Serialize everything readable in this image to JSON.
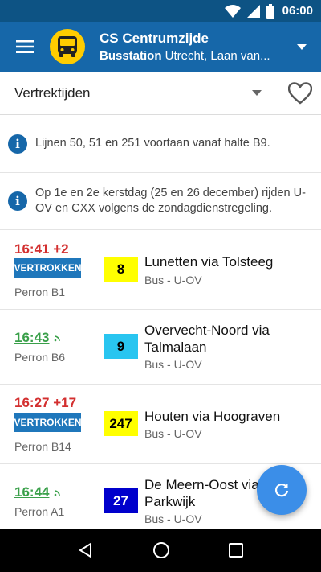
{
  "status": {
    "time": "06:00"
  },
  "app": {
    "title": "CS Centrumzijde",
    "subtitle_bold": "Busstation",
    "subtitle_rest": " Utrecht, Laan van..."
  },
  "filter": {
    "selected": "Vertrektijden"
  },
  "notices": [
    {
      "text": "Lijnen 50, 51 en 251 voortaan vanaf halte B9."
    },
    {
      "text": "Op 1e en 2e kerstdag (25 en 26 december) rijden U-OV en CXX volgens de zondagdienstregeling."
    }
  ],
  "departures": [
    {
      "time": "16:41 +2",
      "status": "VERTROKKEN",
      "perron": "Perron B1",
      "line": "8",
      "line_bg": "#ffff00",
      "line_fg": "#000000",
      "destination": "Lunetten via Tolsteeg",
      "mode": "Bus - U-OV"
    },
    {
      "time": "16:43",
      "perron": "Perron B6",
      "line": "9",
      "line_bg": "#29c5f0",
      "line_fg": "#000000",
      "destination": "Overvecht-Noord via Talmalaan",
      "mode": "Bus - U-OV"
    },
    {
      "time": "16:27 +17",
      "status": "VERTROKKEN",
      "perron": "Perron B14",
      "line": "247",
      "line_bg": "#ffff00",
      "line_fg": "#000000",
      "destination": "Houten via Hoograven",
      "mode": "Bus - U-OV"
    },
    {
      "time": "16:44",
      "perron": "Perron A1",
      "line": "27",
      "line_bg": "#0000cc",
      "line_fg": "#ffffff",
      "destination": "De Meern-Oost via Parkwijk",
      "mode": "Bus - U-OV"
    }
  ],
  "colors": {
    "appbar": "#1667a9",
    "statusbar": "#0d5384",
    "delay": "#d32f2f",
    "realtime": "#3aa04a",
    "fab": "#3b8ee8"
  },
  "icons": {
    "menu": "menu-icon",
    "bus": "bus-icon",
    "favorite": "heart-outline-icon",
    "refresh": "refresh-icon"
  }
}
